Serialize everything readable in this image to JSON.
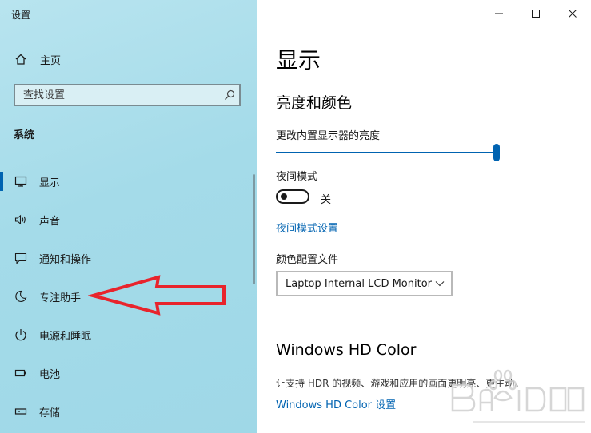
{
  "window": {
    "title": "设置",
    "controls": {
      "minimize": "minimize-icon",
      "maximize": "maximize-icon",
      "close": "close-icon"
    }
  },
  "sidebar": {
    "home": {
      "label": "主页",
      "icon": "home-icon"
    },
    "search": {
      "placeholder": "查找设置",
      "value": "",
      "icon": "search-icon"
    },
    "section_header": "系统",
    "items": [
      {
        "label": "显示",
        "icon": "monitor-icon",
        "selected": true
      },
      {
        "label": "声音",
        "icon": "speaker-icon",
        "selected": false
      },
      {
        "label": "通知和操作",
        "icon": "message-icon",
        "selected": false
      },
      {
        "label": "专注助手",
        "icon": "moon-icon",
        "selected": false
      },
      {
        "label": "电源和睡眠",
        "icon": "power-icon",
        "selected": false
      },
      {
        "label": "电池",
        "icon": "battery-icon",
        "selected": false
      },
      {
        "label": "存储",
        "icon": "storage-icon",
        "selected": false
      }
    ]
  },
  "main": {
    "page_title": "显示",
    "brightness_section": {
      "title": "亮度和颜色",
      "brightness_label": "更改内置显示器的亮度",
      "brightness_value": 100
    },
    "night_light": {
      "label": "夜间模式",
      "toggle_state": "关",
      "on": false,
      "settings_link": "夜间模式设置"
    },
    "color_profile": {
      "label": "颜色配置文件",
      "selected": "Laptop Internal LCD Monitor"
    },
    "hd_color": {
      "title": "Windows HD Color",
      "description": "让支持 HDR 的视频、游戏和应用的画面更明亮、更生动。",
      "link": "Windows HD Color 设置"
    }
  },
  "colors": {
    "accent": "#0063b1",
    "annotation": "#e8242c",
    "sidebar_bg": "#a4dbe9"
  }
}
